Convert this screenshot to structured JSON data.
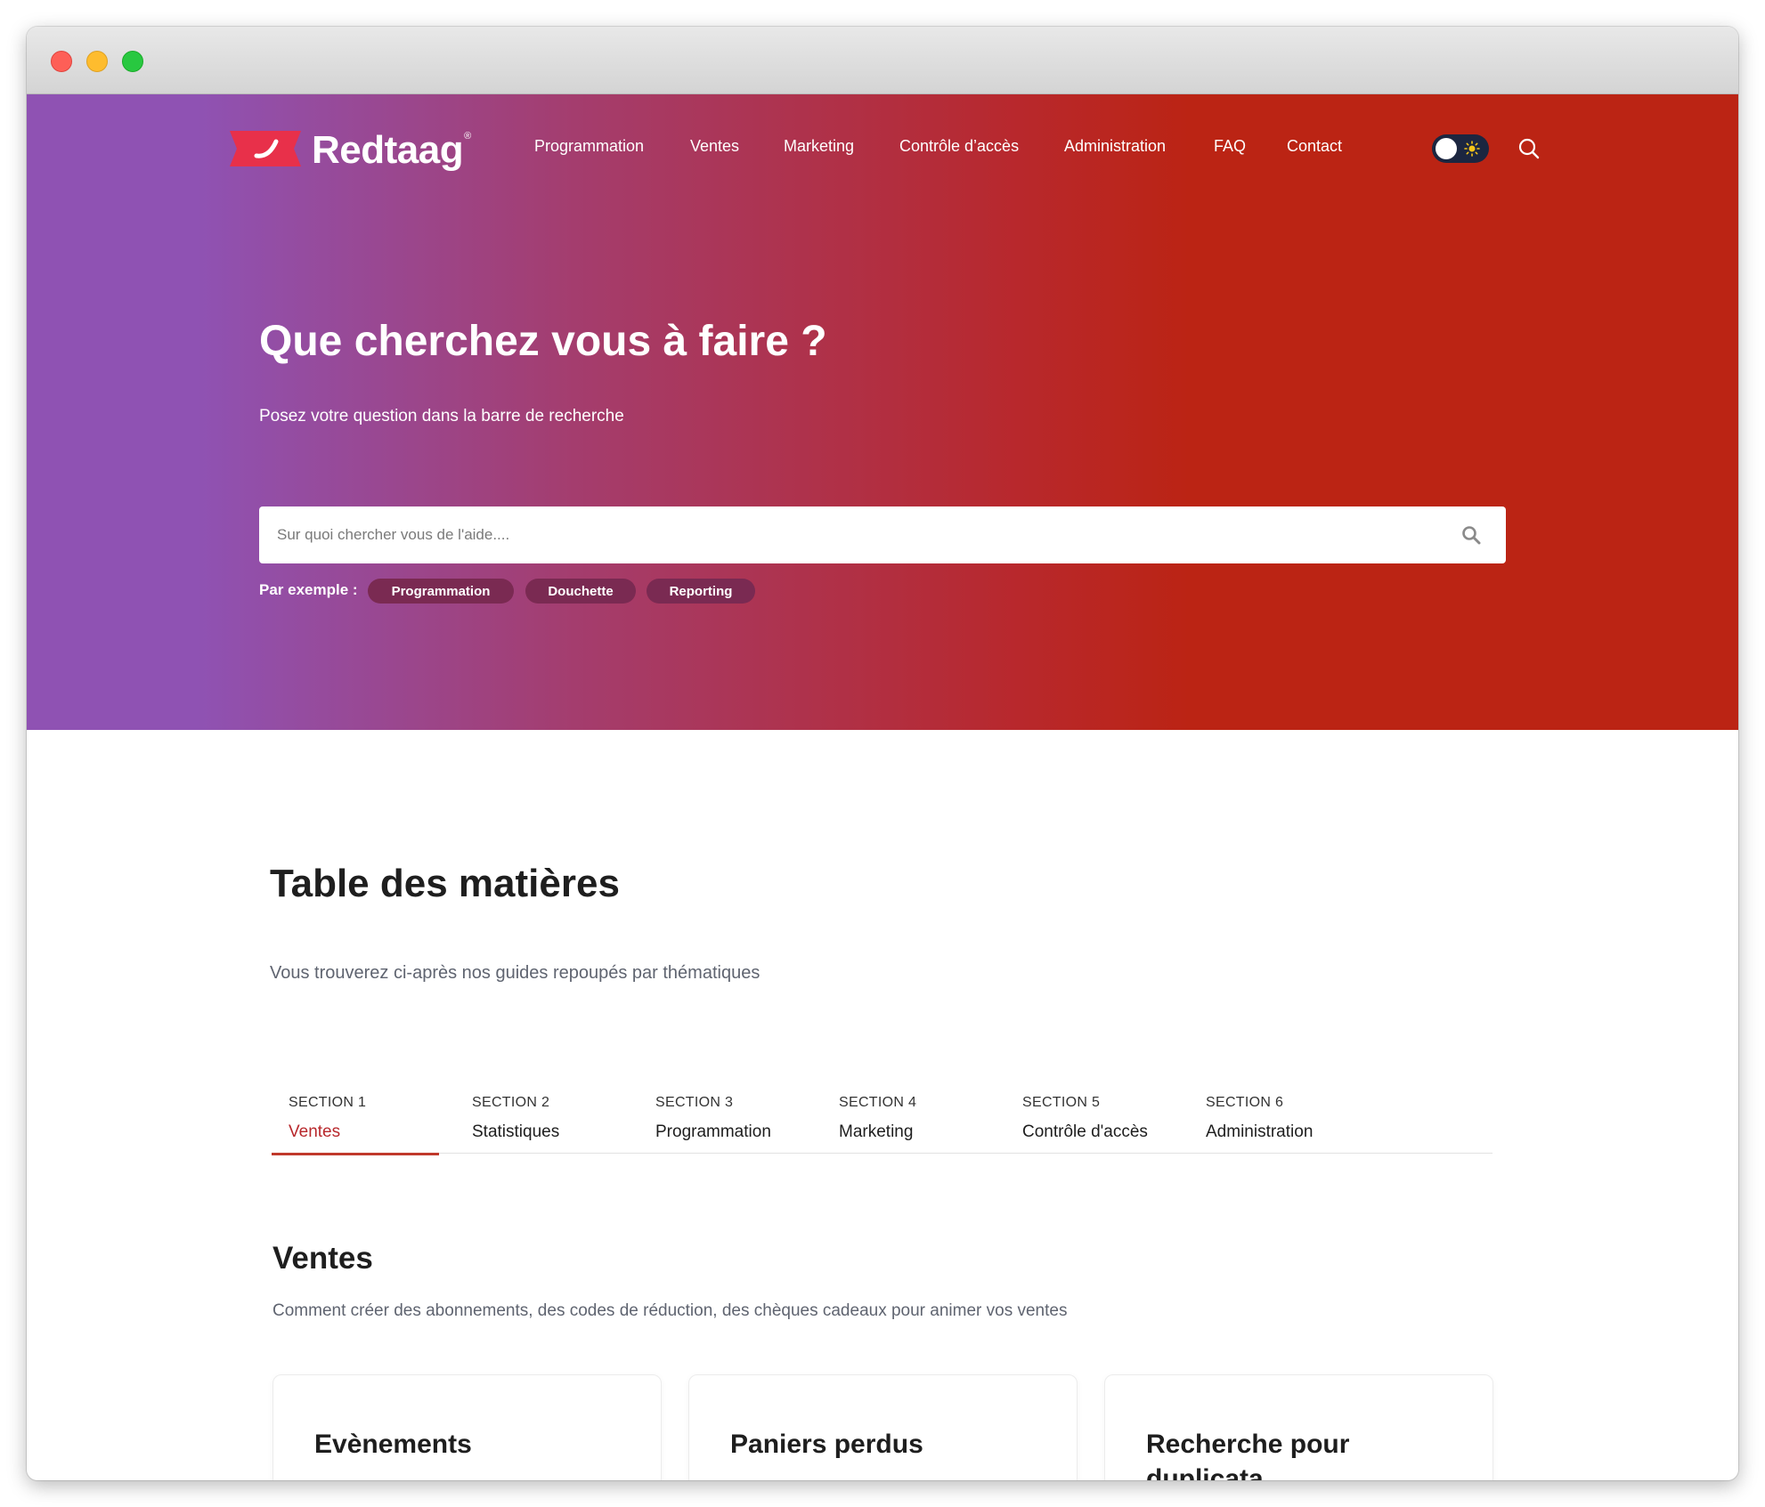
{
  "brand": {
    "name": "Redtaag",
    "reg_mark": "®"
  },
  "nav": {
    "items": [
      {
        "label": "Programmation"
      },
      {
        "label": "Ventes"
      },
      {
        "label": "Marketing"
      },
      {
        "label": "Contrôle d’accès"
      },
      {
        "label": "Administration"
      },
      {
        "label": "FAQ"
      },
      {
        "label": "Contact"
      }
    ],
    "theme_toggle": "light",
    "search_icon": "search-icon"
  },
  "hero": {
    "title": "Que cherchez vous à faire ?",
    "subtitle": "Posez votre question dans la barre de recherche",
    "search_placeholder": "Sur quoi chercher vous de l'aide....",
    "search_value": "",
    "examples_label": "Par exemple :",
    "examples": [
      "Programmation",
      "Douchette",
      "Reporting"
    ]
  },
  "content": {
    "title": "Table des matières",
    "subtitle": "Vous trouverez ci-après nos guides repoupés par thématiques",
    "tabs": [
      {
        "number": "SECTION 1",
        "name": "Ventes"
      },
      {
        "number": "SECTION 2",
        "name": "Statistiques"
      },
      {
        "number": "SECTION 3",
        "name": "Programmation"
      },
      {
        "number": "SECTION 4",
        "name": "Marketing"
      },
      {
        "number": "SECTION 5",
        "name": "Contrôle d'accès"
      },
      {
        "number": "SECTION 6",
        "name": "Administration"
      }
    ],
    "active_tab": "Ventes",
    "section": {
      "title": "Ventes",
      "description": "Comment créer des abonnements, des codes de réduction, des chèques cadeaux pour animer vos ventes",
      "cards": [
        {
          "title": "Evènements"
        },
        {
          "title": "Paniers perdus"
        },
        {
          "title": "Recherche pour duplicata"
        }
      ]
    }
  },
  "colors": {
    "hero_gradient_start": "#8f52b3",
    "hero_gradient_end": "#bb2414",
    "accent": "#c0392b",
    "chip_bg": "#7a2a52",
    "toggle_bg": "#1c2640"
  }
}
